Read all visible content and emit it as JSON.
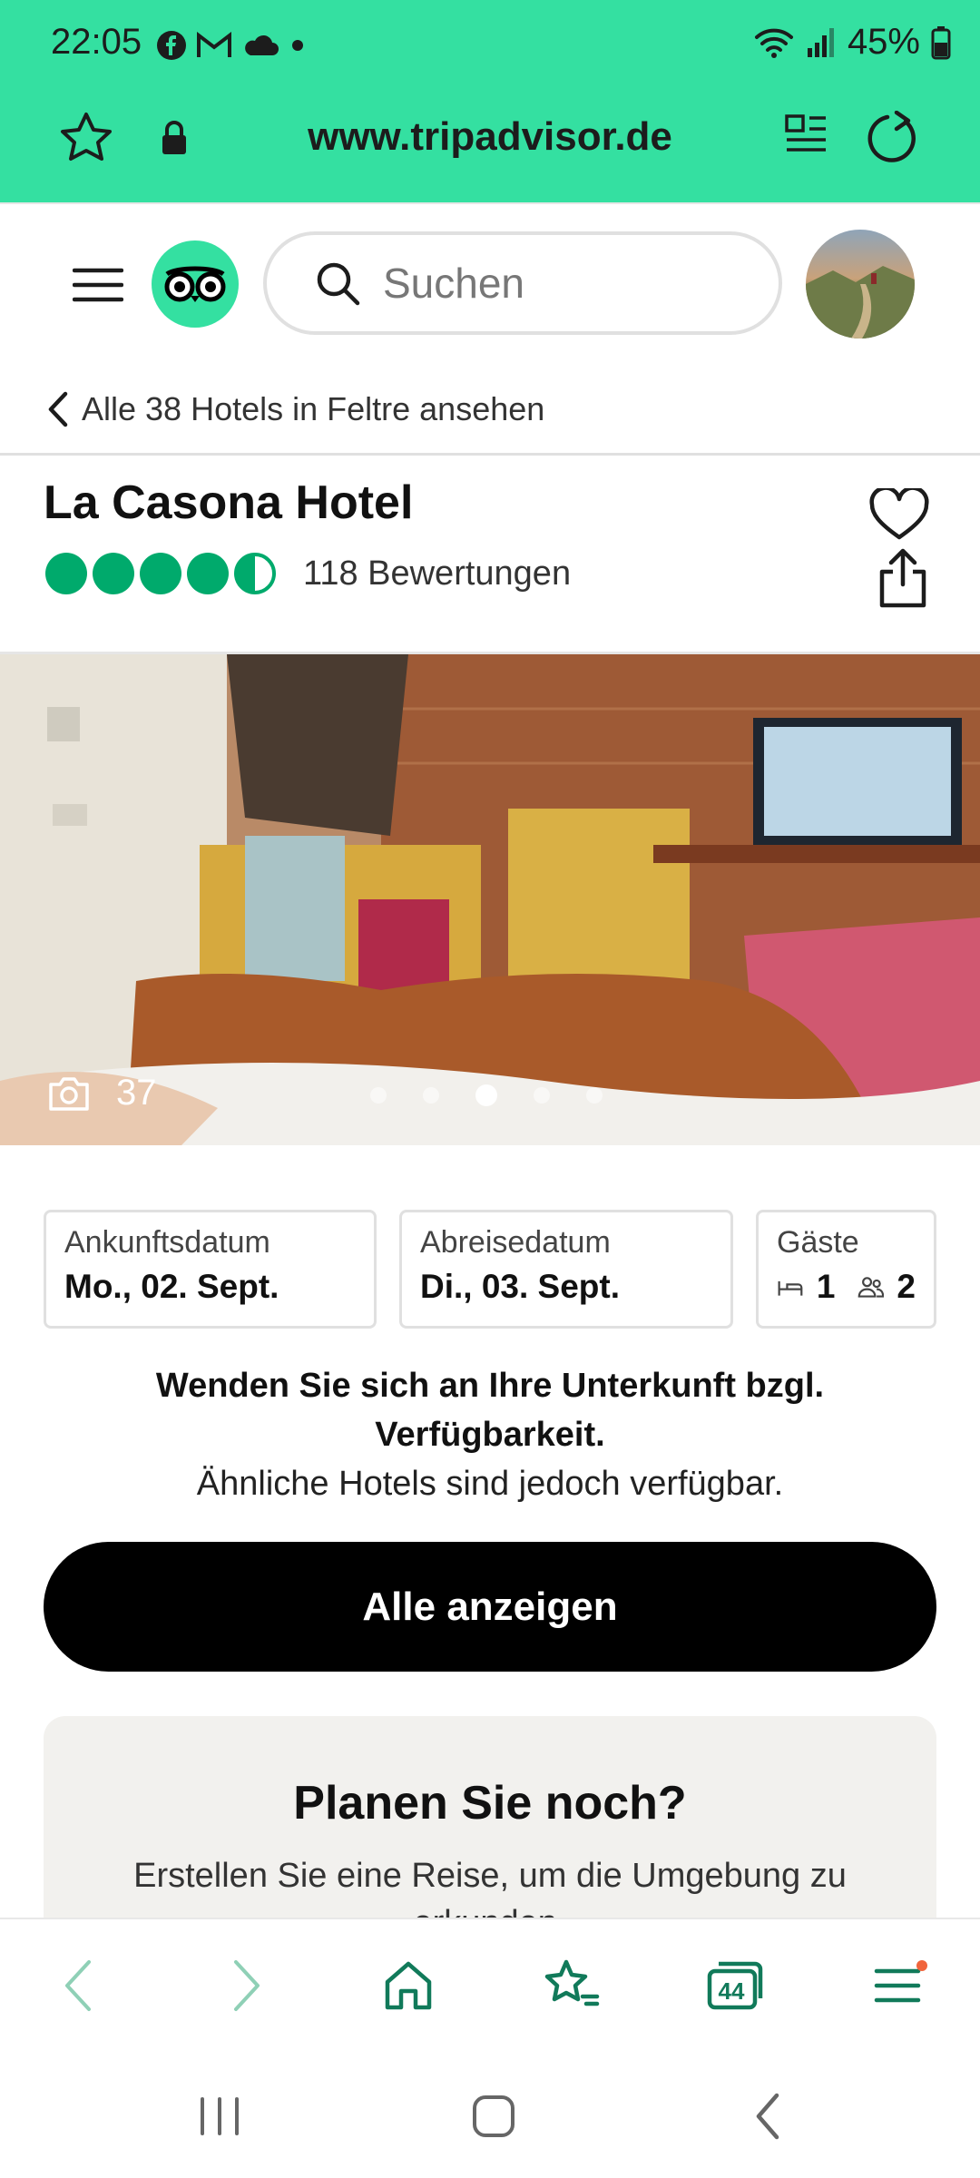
{
  "status_bar": {
    "time": "22:05",
    "battery": "45%",
    "icons": [
      "facebook-icon",
      "gmail-icon",
      "cloud-icon",
      "dot-icon",
      "wifi-icon",
      "signal-icon",
      "battery-icon"
    ]
  },
  "url_bar": {
    "url": "www.tripadvisor.de",
    "icons": [
      "bookmark-star-icon",
      "lock-icon",
      "reader-mode-icon",
      "reload-icon"
    ]
  },
  "site_header": {
    "search_placeholder": "Suchen",
    "icons": [
      "menu-icon",
      "tripadvisor-logo",
      "search-icon",
      "avatar"
    ]
  },
  "back_link": "Alle 38 Hotels in Feltre ansehen",
  "hotel": {
    "name": "La Casona Hotel",
    "rating": 4.5,
    "rating_max": 5,
    "reviews": "118 Bewertungen"
  },
  "gallery": {
    "photo_count": "37",
    "dot_count": 5,
    "active_dot": 3
  },
  "booking": {
    "arrival_label": "Ankunftsdatum",
    "arrival_value": "Mo., 02. Sept.",
    "departure_label": "Abreisedatum",
    "departure_value": "Di., 03. Sept.",
    "guests_label": "Gäste",
    "rooms": "1",
    "guests": "2"
  },
  "notice": {
    "line1": "Wenden Sie sich an Ihre Unterkunft bzgl.",
    "line2": "Verfügbarkeit.",
    "line3": "Ähnliche Hotels sind jedoch verfügbar."
  },
  "cta_label": "Alle anzeigen",
  "plan_card": {
    "title": "Planen Sie noch?",
    "subtitle": "Erstellen Sie eine Reise, um die Umgebung zu erkunden."
  },
  "browser_toolbar": {
    "tab_count": "44",
    "icons": [
      "back-arrow-icon",
      "forward-arrow-icon",
      "home-icon",
      "bookmarks-icon",
      "tabs-icon",
      "menu-icon"
    ],
    "accent": "#117a5a",
    "notification_dot": "#f0643c"
  },
  "colors": {
    "brand_green": "#34e0a1",
    "rating_green": "#00aa6c",
    "cta_black": "#000000"
  }
}
